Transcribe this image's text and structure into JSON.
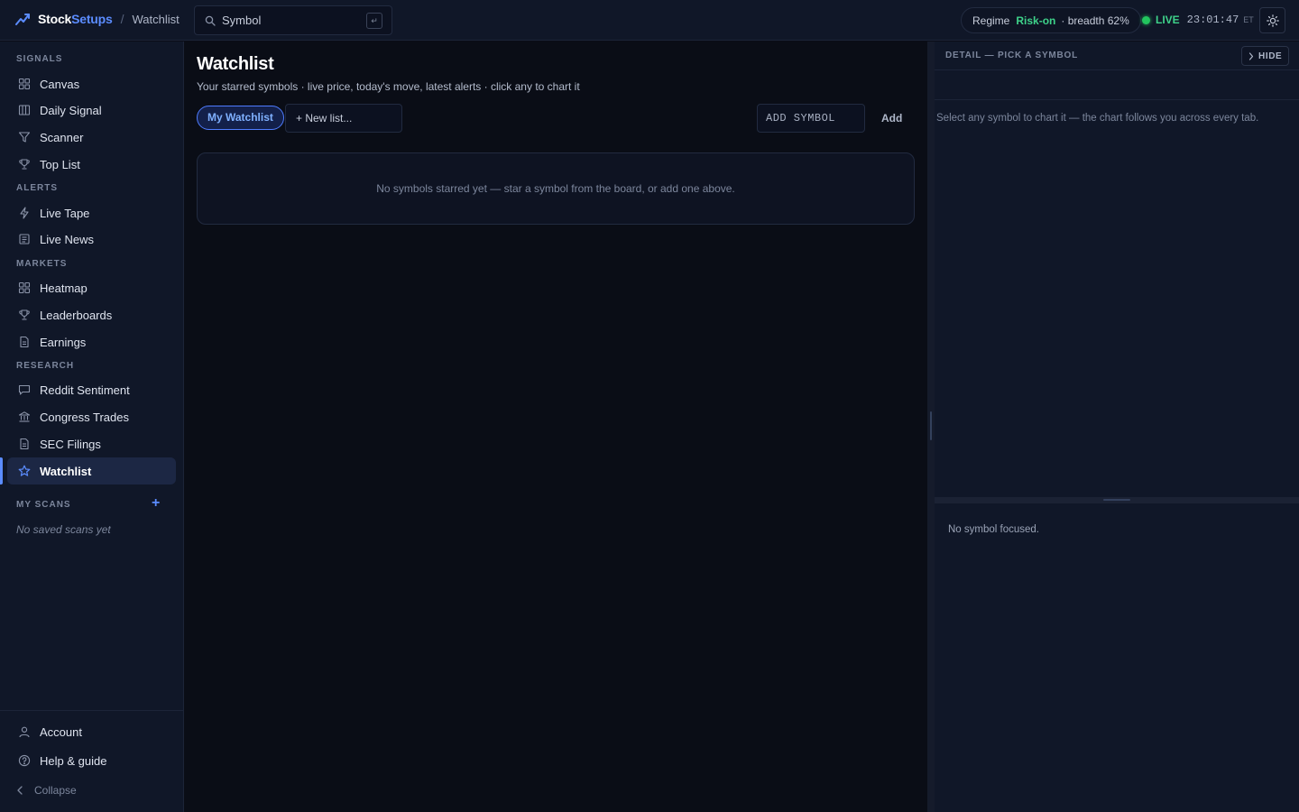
{
  "brand": {
    "name_a": "Stock",
    "name_b": "Setups"
  },
  "breadcrumb": {
    "current": "Watchlist"
  },
  "search": {
    "placeholder": "Symbol",
    "shortcut": "↵"
  },
  "regime": {
    "label": "Regime",
    "value": "Risk-on",
    "breadth": "· breadth 62%"
  },
  "status": {
    "live": "LIVE",
    "time": "23:01:47",
    "tz": "ET"
  },
  "sidebar": {
    "sections": [
      {
        "label": "SIGNALS",
        "items": [
          {
            "label": "Canvas",
            "icon": "grid-icon"
          },
          {
            "label": "Daily Signal",
            "icon": "columns-icon"
          },
          {
            "label": "Scanner",
            "icon": "filter-icon"
          },
          {
            "label": "Top List",
            "icon": "trophy-icon"
          }
        ]
      },
      {
        "label": "ALERTS",
        "items": [
          {
            "label": "Live Tape",
            "icon": "bolt-icon"
          },
          {
            "label": "Live News",
            "icon": "newspaper-icon"
          }
        ]
      },
      {
        "label": "MARKETS",
        "items": [
          {
            "label": "Heatmap",
            "icon": "grid-icon"
          },
          {
            "label": "Leaderboards",
            "icon": "trophy-icon"
          },
          {
            "label": "Earnings",
            "icon": "document-icon"
          }
        ]
      },
      {
        "label": "RESEARCH",
        "items": [
          {
            "label": "Reddit Sentiment",
            "icon": "chat-icon"
          },
          {
            "label": "Congress Trades",
            "icon": "bank-icon"
          },
          {
            "label": "SEC Filings",
            "icon": "document-icon"
          },
          {
            "label": "Watchlist",
            "icon": "star-icon",
            "active": true
          }
        ]
      }
    ],
    "my_scans": {
      "label": "MY SCANS",
      "add": "+",
      "empty": "No saved scans yet"
    },
    "bottom": {
      "account": "Account",
      "help": "Help & guide",
      "collapse": "Collapse"
    }
  },
  "main": {
    "title": "Watchlist",
    "subtitle": "Your starred symbols · live price, today's move, latest alerts · click any to chart it",
    "active_list": "My Watchlist",
    "new_list": "+ New list...",
    "add_placeholder": "ADD SYMBOL",
    "add_button": "Add",
    "empty_message": "No symbols starred yet — star a symbol from the board, or add one above."
  },
  "detail": {
    "title": "DETAIL — PICK A SYMBOL",
    "hide": "HIDE",
    "hint": "Select any symbol to chart it — the chart follows you across every tab.",
    "no_focus": "No symbol focused."
  },
  "colors": {
    "accent": "#5b8cff",
    "positive": "#3ed28a",
    "live": "#22c55e",
    "background": "#0a0d16",
    "panel": "#101728"
  }
}
